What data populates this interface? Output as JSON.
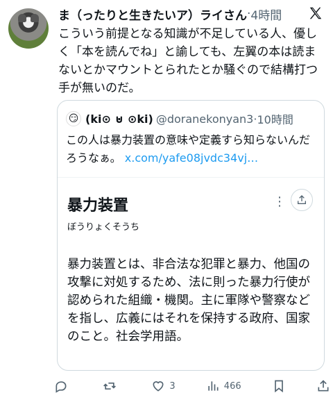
{
  "post": {
    "author": "ま（ったりと生きたいア）ライさん",
    "separator": "·",
    "time": "4時間",
    "text": "こういう前提となる知識が不足している人、優しく「本を読んでね」と諭しても、左翼の本は読まないとかマウントとられたとか騒ぐので結構打つ手が無いのだ。"
  },
  "quote": {
    "avatar_glyph": "😏",
    "name": "(ki⊙ ⊍ ⊙ki)",
    "handle": "@doranekonyan3",
    "separator": "·",
    "time": "10時間",
    "text": "この人は暴力装置の意味や定義すら知らないんだろうなぁ。",
    "link": "x.com/yafe08jvdc34vj…"
  },
  "card": {
    "title": "暴力装置",
    "reading": "ぼうりょくそうち",
    "more_label": "⋮",
    "definition": "暴力装置とは、非合法な犯罪と暴力、他国の攻撃に対処するため、法に則った暴力行使が認められた組織・機関。主に軍隊や警察などを指し、広義にはそれを保持する政府、国家のこと。社会学用語。"
  },
  "actions": {
    "reply_count": "",
    "repost_count": "",
    "like_count": "3",
    "views_count": "466"
  },
  "icons": {
    "logo": "x-logo-icon",
    "reply": "reply-icon",
    "repost": "repost-icon",
    "like": "heart-icon",
    "views": "views-chart-icon",
    "bookmark": "bookmark-icon",
    "share": "share-icon"
  },
  "colors": {
    "text": "#0f1419",
    "secondary": "#536471",
    "link": "#1d9bf0",
    "border": "#cfd9de"
  }
}
